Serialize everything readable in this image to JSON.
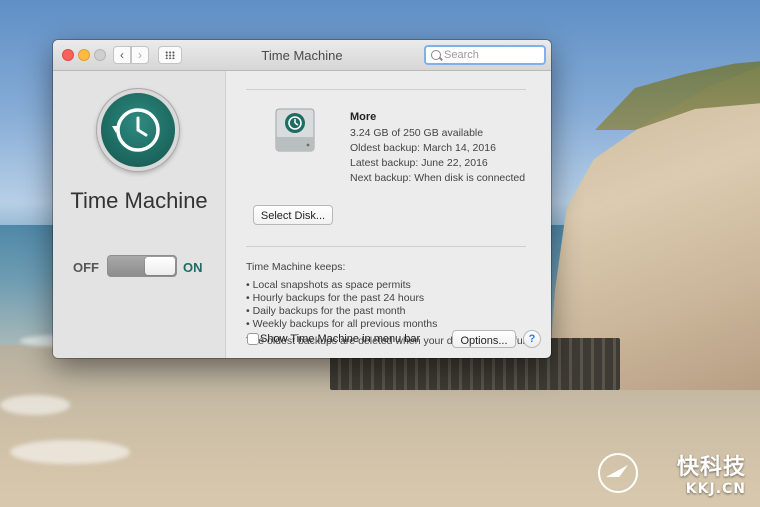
{
  "window": {
    "title": "Time Machine"
  },
  "toolbar": {
    "back_icon": "chevron-left-icon",
    "forward_icon": "chevron-right-icon",
    "grid_icon": "grid-icon",
    "search_placeholder": "Search",
    "search_value": ""
  },
  "sidebar": {
    "app_name": "Time Machine",
    "toggle": {
      "off_label": "OFF",
      "on_label": "ON",
      "state": "on"
    }
  },
  "disk": {
    "name": "More",
    "available": "3.24 GB of 250 GB available",
    "oldest_backup": "Oldest backup: March 14, 2016",
    "latest_backup": "Latest backup: June 22, 2016",
    "next_backup": "Next backup: When disk is connected",
    "select_disk_label": "Select Disk..."
  },
  "keeps": {
    "title": "Time Machine keeps:",
    "items": [
      "• Local snapshots as space permits",
      "• Hourly backups for the past 24 hours",
      "• Daily backups for the past month",
      "• Weekly backups for all previous months"
    ],
    "note": "The oldest backups are deleted when your disk becomes full."
  },
  "footer": {
    "show_in_menu_label": "Show Time Machine in menu bar",
    "show_in_menu_checked": false,
    "options_label": "Options...",
    "help_label": "?"
  },
  "watermark": {
    "cn": "快科技",
    "en": "KKJ.CN"
  },
  "colors": {
    "accent": "#1e6c63",
    "search_focus": "#7fb0ea",
    "close": "#fc605b",
    "minimize": "#fdbc40"
  }
}
